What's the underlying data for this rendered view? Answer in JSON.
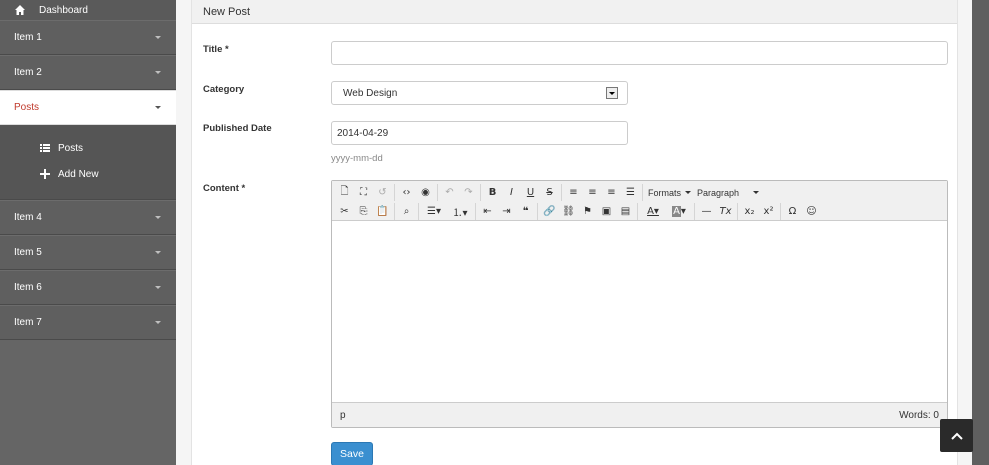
{
  "sidebar": {
    "dashboard": {
      "label": "Dashboard",
      "icon": "home-icon"
    },
    "items": [
      {
        "label": "Item 1"
      },
      {
        "label": "Item 2"
      },
      {
        "label": "Posts",
        "active": true
      },
      {
        "label": "Item 4"
      },
      {
        "label": "Item 5"
      },
      {
        "label": "Item 6"
      },
      {
        "label": "Item 7"
      }
    ],
    "posts_submenu": [
      {
        "label": "Posts",
        "icon": "list-icon"
      },
      {
        "label": "Add New",
        "icon": "plus-icon"
      }
    ]
  },
  "panel": {
    "title": "New Post"
  },
  "form": {
    "title_label": "Title *",
    "title_value": "",
    "category_label": "Category",
    "category_value": "Web Design",
    "published_label": "Published Date",
    "published_value": "2014-04-29",
    "published_help": "yyyy-mm-dd",
    "content_label": "Content *",
    "save_label": "Save"
  },
  "editor": {
    "formats_label": "Formats",
    "paragraph_label": "Paragraph",
    "status_path": "p",
    "word_count": "Words: 0"
  },
  "colors": {
    "sidebar_bg": "#5f5f5f",
    "active_text": "#c0392b",
    "primary_button": "#3a8fd0"
  }
}
